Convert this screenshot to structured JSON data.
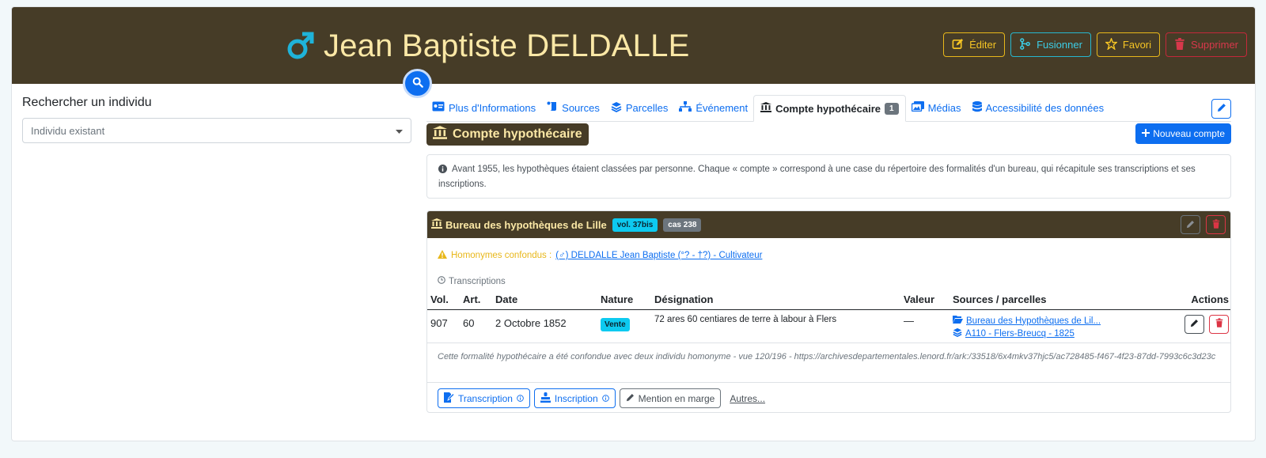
{
  "header": {
    "name": "Jean Baptiste DELDALLE",
    "gender_icon": "male-symbol-icon",
    "actions": {
      "edit": "Éditer",
      "merge": "Fusionner",
      "favorite": "Favori",
      "delete": "Supprimer"
    }
  },
  "search": {
    "title": "Rechercher un individu",
    "placeholder": "Individu existant"
  },
  "tabs": [
    {
      "label": "Plus d'Informations"
    },
    {
      "label": "Sources"
    },
    {
      "label": "Parcelles"
    },
    {
      "label": "Événement"
    },
    {
      "label": "Compte hypothécaire",
      "count": "1"
    },
    {
      "label": "Médias"
    },
    {
      "label": "Accessibilité des données"
    }
  ],
  "section": {
    "title": "Compte hypothécaire",
    "new_button": "Nouveau compte",
    "info": "Avant 1955, les hypothèques étaient classées par personne. Chaque « compte » correspond à une case du répertoire des formalités d'un bureau, qui récapitule ses transcriptions et ses inscriptions."
  },
  "account": {
    "bureau": "Bureau des hypothèques de Lille",
    "volume": "vol. 37bis",
    "case": "cas 238",
    "homonymes_label": "Homonymes confondus :",
    "homonymes_link": "(♂) DELDALLE Jean Baptiste (°? - †?) - Cultivateur",
    "transcriptions_label": "Transcriptions",
    "columns": {
      "vol": "Vol.",
      "art": "Art.",
      "date": "Date",
      "nature": "Nature",
      "designation": "Désignation",
      "valeur": "Valeur",
      "sources": "Sources / parcelles",
      "actions": "Actions"
    },
    "rows": [
      {
        "vol": "907",
        "art": "60",
        "date": "2 Octobre 1852",
        "nature": "Vente",
        "designation": "72 ares 60 centiares de terre à labour à Flers",
        "valeur": "—",
        "source": "Bureau des Hypothèques de Lil...",
        "parcelle": "A110 - Flers-Breucq - 1825"
      }
    ],
    "note": "Cette formalité hypothécaire a été confondue avec deux individu homonyme - vue 120/196 - https://archivesdepartementales.lenord.fr/ark:/33518/6x4mkv37hjc5/ac728485-f467-4f23-87dd-7993c6c3d23c",
    "footer": {
      "transcription": "Transcription",
      "inscription": "Inscription",
      "mention": "Mention en marge",
      "more": "Autres..."
    }
  },
  "colors": {
    "header_bg": "#463c27",
    "header_text": "#fbe8a6",
    "primary": "#0d6ef0",
    "info": "#0dcaf0",
    "warning": "#e8b71a",
    "danger": "#dc3545"
  }
}
